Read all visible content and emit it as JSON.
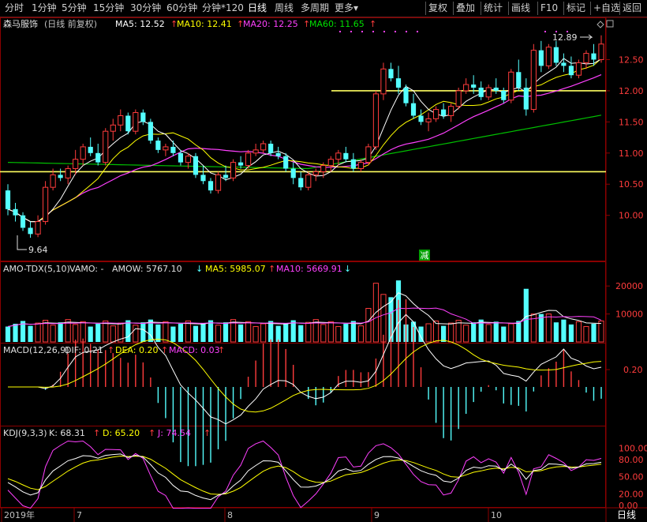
{
  "toolbar": {
    "left_items": [
      "分时",
      "1分钟",
      "5分钟",
      "15分钟",
      "30分钟",
      "60分钟",
      "分钟*120",
      "日线",
      "周线",
      "多周期",
      "更多"
    ],
    "active": "日线",
    "right_items": [
      "复权",
      "叠加",
      "统计",
      "画线",
      "F10",
      "标记",
      "+自选",
      "返回"
    ]
  },
  "main_panel": {
    "stock_name": "森马服饰",
    "period_info": "(日线 前复权)",
    "ma5": {
      "label": "MA5: 12.52",
      "color": "#ffffff"
    },
    "ma10": {
      "label": "MA10: 12.41",
      "color": "#ffff00"
    },
    "ma20": {
      "label": "MA20: 12.25",
      "color": "#ff40ff"
    },
    "ma60": {
      "label": "MA60: 11.65",
      "color": "#00e000"
    },
    "y_ticks": [
      "12.50",
      "12.00",
      "11.50",
      "11.00",
      "10.50",
      "10.00"
    ],
    "high_label": "12.89",
    "low_label": "9.64",
    "marker": "减"
  },
  "volume_panel": {
    "indicator": "AMO-TDX(5,10)",
    "vamo": "VAMO: -",
    "amow": "AMOW: 5767.10",
    "ma5": "MA5: 5985.07",
    "ma10": "MA10: 5669.91",
    "y_ticks": [
      "20000",
      "10000"
    ]
  },
  "macd_panel": {
    "indicator": "MACD(12,26,9)",
    "dif": "DIF: 0.21",
    "dea": "DEA: 0.20",
    "macd": "MACD: 0.03",
    "y_ticks": [
      "0.20"
    ]
  },
  "kdj_panel": {
    "indicator": "KDJ(9,3,3)",
    "k": "K: 68.31",
    "d": "D: 65.20",
    "j": "J: 74.54",
    "y_ticks": [
      "100.00",
      "80.00",
      "50.00",
      "20.00",
      "0.00"
    ]
  },
  "x_axis": {
    "labels": [
      "2019年",
      "7",
      "8",
      "9",
      "10"
    ],
    "period": "日线"
  },
  "colors": {
    "up": "#ff3c3c",
    "down": "#54ffff",
    "support_line": "#ffff60",
    "grid": "#8b0000"
  },
  "chart_data": {
    "type": "candlestick",
    "candles": [
      [
        10.4,
        10.5,
        10.0,
        10.1
      ],
      [
        10.1,
        10.2,
        9.9,
        10.0
      ],
      [
        10.0,
        10.05,
        9.75,
        9.8
      ],
      [
        9.8,
        9.9,
        9.64,
        9.7
      ],
      [
        9.7,
        10.0,
        9.65,
        9.9
      ],
      [
        9.9,
        10.55,
        9.85,
        10.45
      ],
      [
        10.45,
        10.75,
        10.4,
        10.65
      ],
      [
        10.65,
        10.75,
        10.55,
        10.6
      ],
      [
        10.6,
        10.8,
        10.5,
        10.75
      ],
      [
        10.75,
        11.05,
        10.65,
        10.9
      ],
      [
        10.9,
        11.15,
        10.8,
        11.1
      ],
      [
        11.1,
        11.25,
        10.95,
        11.0
      ],
      [
        11.0,
        11.15,
        10.8,
        10.85
      ],
      [
        10.85,
        11.4,
        10.8,
        11.35
      ],
      [
        11.35,
        11.55,
        11.2,
        11.45
      ],
      [
        11.45,
        11.7,
        11.35,
        11.6
      ],
      [
        11.6,
        11.65,
        11.3,
        11.35
      ],
      [
        11.35,
        11.7,
        11.3,
        11.65
      ],
      [
        11.65,
        11.7,
        11.45,
        11.5
      ],
      [
        11.5,
        11.55,
        11.15,
        11.2
      ],
      [
        11.2,
        11.25,
        11.0,
        11.05
      ],
      [
        11.05,
        11.15,
        10.95,
        11.1
      ],
      [
        11.1,
        11.2,
        10.95,
        11.0
      ],
      [
        11.0,
        11.05,
        10.8,
        10.85
      ],
      [
        10.85,
        11.0,
        10.75,
        10.95
      ],
      [
        10.95,
        11.0,
        10.6,
        10.65
      ],
      [
        10.65,
        10.8,
        10.5,
        10.55
      ],
      [
        10.55,
        10.6,
        10.35,
        10.4
      ],
      [
        10.4,
        10.7,
        10.35,
        10.65
      ],
      [
        10.65,
        10.8,
        10.55,
        10.6
      ],
      [
        10.6,
        10.9,
        10.55,
        10.85
      ],
      [
        10.85,
        10.95,
        10.75,
        10.8
      ],
      [
        10.8,
        11.05,
        10.75,
        11.0
      ],
      [
        11.0,
        11.15,
        10.95,
        11.05
      ],
      [
        11.05,
        11.2,
        11.0,
        11.15
      ],
      [
        11.15,
        11.2,
        10.95,
        11.0
      ],
      [
        11.0,
        11.1,
        10.9,
        10.95
      ],
      [
        10.95,
        11.0,
        10.7,
        10.75
      ],
      [
        10.75,
        10.85,
        10.5,
        10.6
      ],
      [
        10.6,
        10.7,
        10.4,
        10.45
      ],
      [
        10.45,
        10.7,
        10.4,
        10.65
      ],
      [
        10.65,
        10.75,
        10.55,
        10.7
      ],
      [
        10.7,
        10.85,
        10.6,
        10.8
      ],
      [
        10.8,
        10.95,
        10.7,
        10.9
      ],
      [
        10.9,
        11.05,
        10.8,
        11.0
      ],
      [
        11.0,
        11.1,
        10.85,
        10.9
      ],
      [
        10.9,
        11.0,
        10.7,
        10.75
      ],
      [
        10.75,
        10.9,
        10.7,
        10.85
      ],
      [
        10.85,
        11.15,
        10.8,
        11.1
      ],
      [
        11.1,
        12.0,
        11.05,
        11.95
      ],
      [
        11.95,
        12.45,
        11.85,
        12.35
      ],
      [
        12.35,
        12.45,
        12.15,
        12.2
      ],
      [
        12.2,
        12.4,
        11.95,
        12.05
      ],
      [
        12.05,
        12.1,
        11.75,
        11.8
      ],
      [
        11.8,
        11.95,
        11.55,
        11.6
      ],
      [
        11.6,
        11.7,
        11.45,
        11.5
      ],
      [
        11.5,
        11.65,
        11.35,
        11.55
      ],
      [
        11.55,
        11.75,
        11.5,
        11.7
      ],
      [
        11.7,
        11.8,
        11.55,
        11.6
      ],
      [
        11.6,
        11.8,
        11.5,
        11.75
      ],
      [
        11.75,
        12.05,
        11.7,
        12.0
      ],
      [
        12.0,
        12.2,
        11.95,
        12.1
      ],
      [
        12.1,
        12.25,
        11.95,
        12.05
      ],
      [
        12.05,
        12.15,
        11.85,
        11.9
      ],
      [
        11.9,
        12.1,
        11.85,
        12.05
      ],
      [
        12.05,
        12.2,
        11.95,
        12.0
      ],
      [
        12.0,
        12.05,
        11.8,
        11.85
      ],
      [
        11.85,
        12.35,
        11.8,
        12.3
      ],
      [
        12.3,
        12.5,
        12.0,
        12.05
      ],
      [
        12.05,
        12.2,
        11.6,
        11.7
      ],
      [
        11.7,
        12.75,
        11.65,
        12.65
      ],
      [
        12.65,
        12.8,
        12.3,
        12.4
      ],
      [
        12.4,
        12.75,
        12.35,
        12.7
      ],
      [
        12.7,
        12.8,
        12.4,
        12.45
      ],
      [
        12.45,
        12.6,
        12.3,
        12.4
      ],
      [
        12.4,
        12.55,
        12.2,
        12.25
      ],
      [
        12.25,
        12.5,
        12.2,
        12.45
      ],
      [
        12.45,
        12.65,
        12.35,
        12.6
      ],
      [
        12.6,
        12.75,
        12.4,
        12.5
      ],
      [
        12.5,
        12.89,
        12.45,
        12.75
      ]
    ],
    "ylim": [
      9.4,
      12.95
    ]
  }
}
